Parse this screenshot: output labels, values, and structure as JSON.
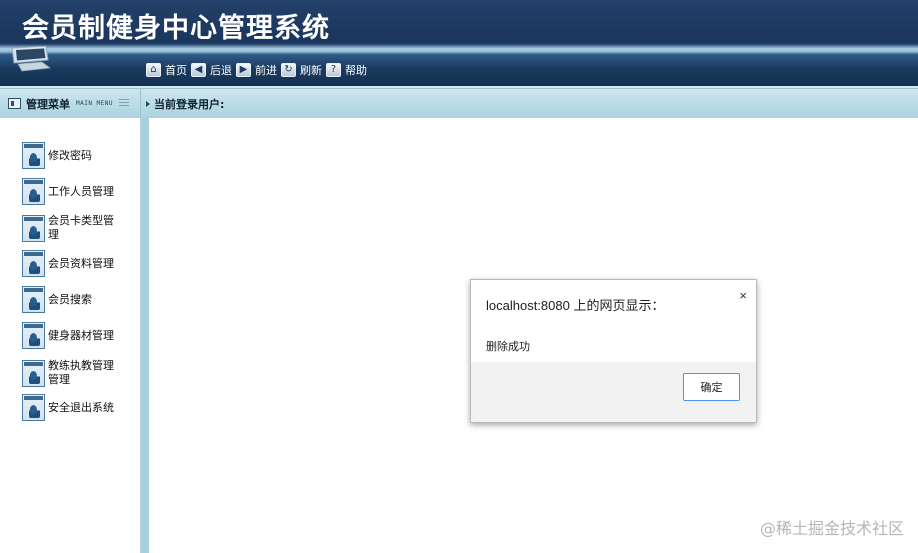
{
  "header": {
    "title": "会员制健身中心管理系统",
    "toolbar": [
      {
        "label": "首页",
        "icon": "home-icon",
        "glyph": "⌂"
      },
      {
        "label": "后退",
        "icon": "back-icon",
        "glyph": "◀"
      },
      {
        "label": "前进",
        "icon": "forward-icon",
        "glyph": "▶"
      },
      {
        "label": "刷新",
        "icon": "refresh-icon",
        "glyph": "↻"
      },
      {
        "label": "帮助",
        "icon": "help-icon",
        "glyph": "?"
      }
    ]
  },
  "navbar": {
    "menu_title": "管理菜单",
    "menu_subtitle": "MAIN MENU",
    "login_label": "当前登录用户:"
  },
  "sidebar": {
    "items": [
      {
        "label": "修改密码"
      },
      {
        "label": "工作人员管理"
      },
      {
        "label": "会员卡类型管理"
      },
      {
        "label": "会员资料管理"
      },
      {
        "label": "会员搜索"
      },
      {
        "label": "健身器材管理"
      },
      {
        "label": "教练执教管理管理"
      },
      {
        "label": "安全退出系统"
      }
    ]
  },
  "dialog": {
    "title": "localhost:8080 上的网页显示：",
    "message": "删除成功",
    "ok_label": "确定",
    "close_glyph": "×"
  },
  "watermark": "@稀土掘金技术社区",
  "colors": {
    "header_dark": "#1b365c",
    "nav_bg": "#aad3de",
    "sidebar_sep": "#a5d0dc",
    "button_border": "#4d90fe"
  }
}
